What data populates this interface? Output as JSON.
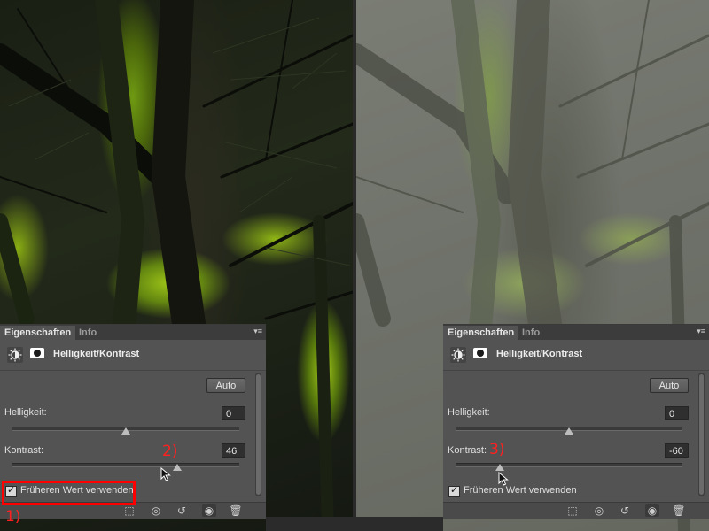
{
  "panels": [
    {
      "tab_active": "Eigenschaften",
      "tab_inactive": "Info",
      "title": "Helligkeit/Kontrast",
      "auto_label": "Auto",
      "brightness_label": "Helligkeit:",
      "brightness_value": "0",
      "contrast_label": "Kontrast:",
      "contrast_value": "46",
      "legacy_label": "Früheren Wert verwenden",
      "legacy_checked": true
    },
    {
      "tab_active": "Eigenschaften",
      "tab_inactive": "Info",
      "title": "Helligkeit/Kontrast",
      "auto_label": "Auto",
      "brightness_label": "Helligkeit:",
      "brightness_value": "0",
      "contrast_label": "Kontrast:",
      "contrast_value": "-60",
      "legacy_label": "Früheren Wert verwenden",
      "legacy_checked": true
    }
  ],
  "annotations": {
    "step1": "1)",
    "step2": "2)",
    "step3": "3)"
  },
  "colors": {
    "panel_bg": "#535353",
    "annotation_red": "#ff0000"
  }
}
